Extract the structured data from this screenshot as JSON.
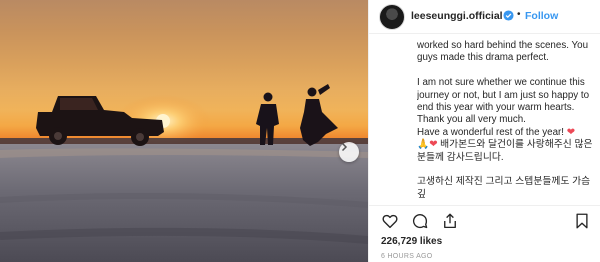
{
  "post": {
    "username": "leeseunggi.official",
    "verified_icon": "verified-badge-icon",
    "separator": "•",
    "follow_label": "Follow",
    "caption": {
      "para1": "worked so hard behind the scenes. You guys made this drama perfect.",
      "para2": "I am not sure whether we continue this journey or not, but I am just so happy to end this year with your warm hearts. Thank you all very much.",
      "line_wonderful": "Have a wonderful rest of the year!",
      "korean1": "배가본드와 달건이를 사랑해주신 많은 분들께 감사드립니다.",
      "korean2": "고생하신 제작진 그리고 스텝분들께도 가슴깊"
    },
    "likes": "226,729 likes",
    "time_ago": "6 HOURS AGO"
  },
  "icons": {
    "like": "heart-outline-icon",
    "comment": "comment-bubble-icon",
    "share": "share-icon",
    "save": "bookmark-icon",
    "next": "chevron-right-icon"
  },
  "colors": {
    "follow": "#3897f0",
    "verified": "#3897f0",
    "heart_emoji": "#ed4956",
    "secondary_text": "#999999"
  }
}
